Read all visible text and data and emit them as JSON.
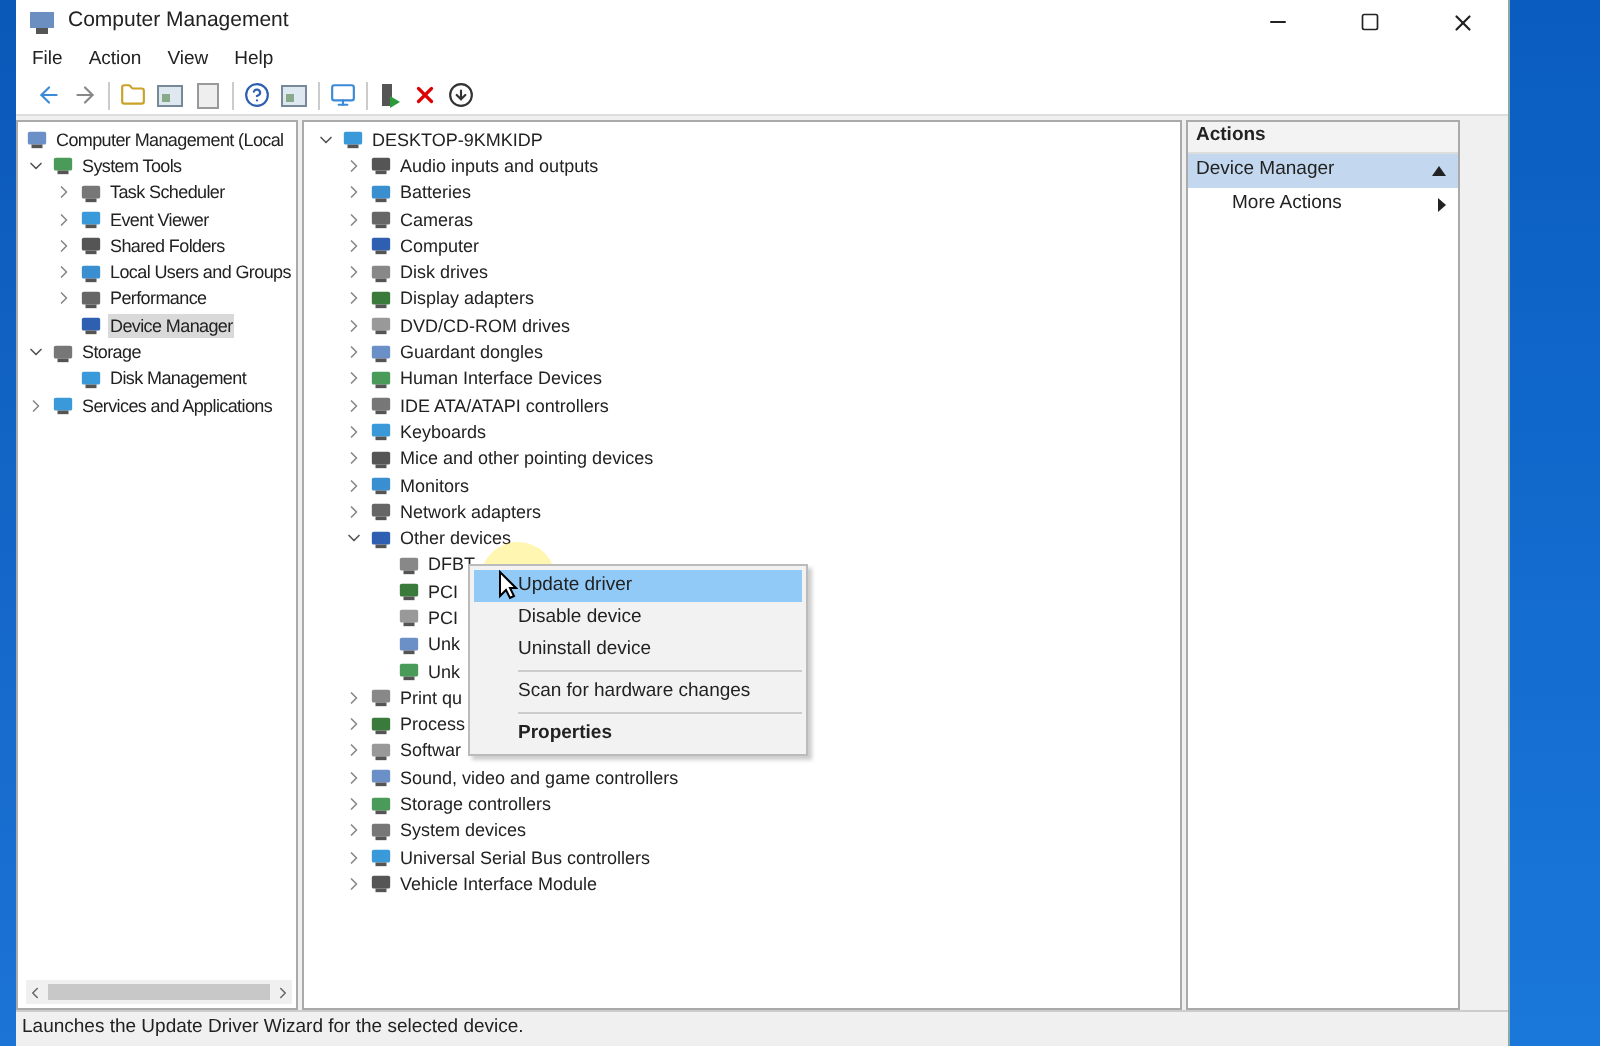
{
  "window": {
    "title": "Computer Management"
  },
  "menu": [
    "File",
    "Action",
    "View",
    "Help"
  ],
  "left_tree": [
    {
      "label": "Computer Management (Local",
      "kind": "root",
      "selected": false,
      "children": [
        {
          "label": "System Tools",
          "kind": "branch",
          "expanded": true,
          "selected": false,
          "children": [
            {
              "label": "Task Scheduler",
              "kind": "branch",
              "expanded": false,
              "selected": false
            },
            {
              "label": "Event Viewer",
              "kind": "branch",
              "expanded": false,
              "selected": false
            },
            {
              "label": "Shared Folders",
              "kind": "branch",
              "expanded": false,
              "selected": false
            },
            {
              "label": "Local Users and Groups",
              "kind": "branch",
              "expanded": false,
              "selected": false
            },
            {
              "label": "Performance",
              "kind": "branch",
              "expanded": false,
              "selected": false
            },
            {
              "label": "Device Manager",
              "kind": "leaf",
              "selected": true
            }
          ]
        },
        {
          "label": "Storage",
          "kind": "branch",
          "expanded": true,
          "selected": false,
          "children": [
            {
              "label": "Disk Management",
              "kind": "leaf",
              "selected": false
            }
          ]
        },
        {
          "label": "Services and Applications",
          "kind": "branch",
          "expanded": false,
          "selected": false
        }
      ]
    }
  ],
  "device_tree": [
    {
      "label": "DESKTOP-9KMKIDP",
      "kind": "branch",
      "expanded": true,
      "children": [
        {
          "label": "Audio inputs and outputs",
          "kind": "branch",
          "expanded": false
        },
        {
          "label": "Batteries",
          "kind": "branch",
          "expanded": false
        },
        {
          "label": "Cameras",
          "kind": "branch",
          "expanded": false
        },
        {
          "label": "Computer",
          "kind": "branch",
          "expanded": false
        },
        {
          "label": "Disk drives",
          "kind": "branch",
          "expanded": false
        },
        {
          "label": "Display adapters",
          "kind": "branch",
          "expanded": false
        },
        {
          "label": "DVD/CD-ROM drives",
          "kind": "branch",
          "expanded": false
        },
        {
          "label": "Guardant dongles",
          "kind": "branch",
          "expanded": false
        },
        {
          "label": "Human Interface Devices",
          "kind": "branch",
          "expanded": false
        },
        {
          "label": "IDE ATA/ATAPI controllers",
          "kind": "branch",
          "expanded": false
        },
        {
          "label": "Keyboards",
          "kind": "branch",
          "expanded": false
        },
        {
          "label": "Mice and other pointing devices",
          "kind": "branch",
          "expanded": false
        },
        {
          "label": "Monitors",
          "kind": "branch",
          "expanded": false
        },
        {
          "label": "Network adapters",
          "kind": "branch",
          "expanded": false
        },
        {
          "label": "Other devices",
          "kind": "branch",
          "expanded": true,
          "children": [
            {
              "label": "DFBT",
              "kind": "leaf"
            },
            {
              "label": "PCI",
              "kind": "leaf"
            },
            {
              "label": "PCI",
              "kind": "leaf"
            },
            {
              "label": "Unk",
              "kind": "leaf"
            },
            {
              "label": "Unk",
              "kind": "leaf"
            }
          ]
        },
        {
          "label": "Print qu",
          "kind": "branch",
          "expanded": false
        },
        {
          "label": "Process",
          "kind": "branch",
          "expanded": false
        },
        {
          "label": "Softwar",
          "kind": "branch",
          "expanded": false
        },
        {
          "label": "Sound, video and game controllers",
          "kind": "branch",
          "expanded": false
        },
        {
          "label": "Storage controllers",
          "kind": "branch",
          "expanded": false
        },
        {
          "label": "System devices",
          "kind": "branch",
          "expanded": false
        },
        {
          "label": "Universal Serial Bus controllers",
          "kind": "branch",
          "expanded": false
        },
        {
          "label": "Vehicle Interface Module",
          "kind": "branch",
          "expanded": false
        }
      ]
    }
  ],
  "context_menu": [
    {
      "kind": "item",
      "label": "Update driver",
      "selected": true,
      "default": false
    },
    {
      "kind": "item",
      "label": "Disable device",
      "selected": false,
      "default": false
    },
    {
      "kind": "item",
      "label": "Uninstall device",
      "selected": false,
      "default": false
    },
    {
      "kind": "separator"
    },
    {
      "kind": "item",
      "label": "Scan for hardware changes",
      "selected": false,
      "default": false
    },
    {
      "kind": "separator"
    },
    {
      "kind": "item",
      "label": "Properties",
      "selected": false,
      "default": true
    }
  ],
  "actions": {
    "title": "Actions",
    "section": "Device Manager",
    "items": [
      "More Actions"
    ]
  },
  "status_bar": "Launches the Update Driver Wizard for the selected device."
}
